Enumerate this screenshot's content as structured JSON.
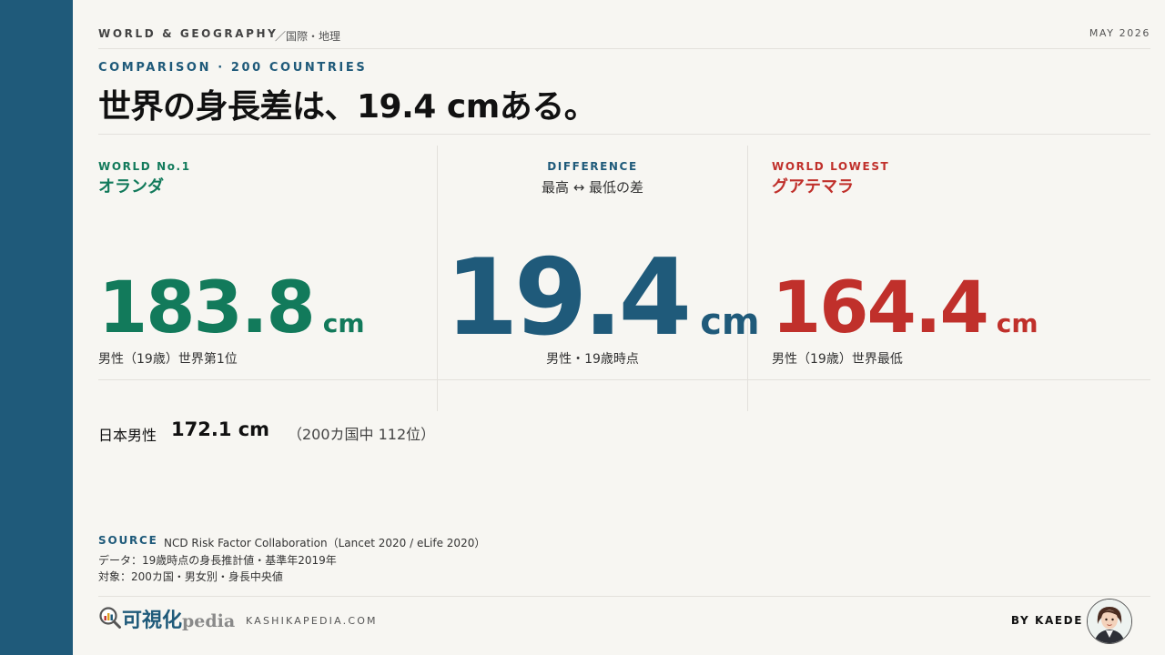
{
  "header": {
    "category": "WORLD & GEOGRAPHY",
    "subcategory": "／国際・地理",
    "date": "MAY 2026"
  },
  "kicker": "COMPARISON · 200 COUNTRIES",
  "headline": "世界の身長差は、19.4 cmある。",
  "stats": {
    "highest": {
      "tag": "WORLD No.1",
      "country": "オランダ",
      "value": "183.8",
      "unit": "cm",
      "note": "男性（19歳）世界第1位",
      "color": "#127a5b"
    },
    "difference": {
      "tag": "DIFFERENCE",
      "subtitle": "最高 ↔ 最低の差",
      "value": "19.4",
      "unit": "cm",
      "note": "男性・19歳時点",
      "color": "#1f5a7a"
    },
    "lowest": {
      "tag": "WORLD LOWEST",
      "country": "グアテマラ",
      "value": "164.4",
      "unit": "cm",
      "note": "男性（19歳）世界最低",
      "color": "#c0302b"
    }
  },
  "japan": {
    "label": "日本男性",
    "value": "172.1 cm",
    "rank": "（200カ国中 112位）"
  },
  "source": {
    "label": "SOURCE",
    "text": "NCD Risk Factor Collaboration（Lancet 2020 / eLife 2020）",
    "lines": [
      "データ：19歳時点の身長推計値・基準年2019年",
      "対象：200カ国・男女別・身長中央値"
    ]
  },
  "footer": {
    "logo_main": "可視化",
    "logo_sub": "pedia",
    "url": "KASHIKAPEDIA.COM",
    "byline": "BY KAEDE"
  },
  "icons": {
    "logo": "magnifier-chart-icon",
    "avatar": "author-avatar"
  },
  "colors": {
    "sidebar": "#1f5a7a",
    "background": "#f7f6f2",
    "accent_green": "#127a5b",
    "accent_blue": "#1f5a7a",
    "accent_red": "#c0302b"
  }
}
